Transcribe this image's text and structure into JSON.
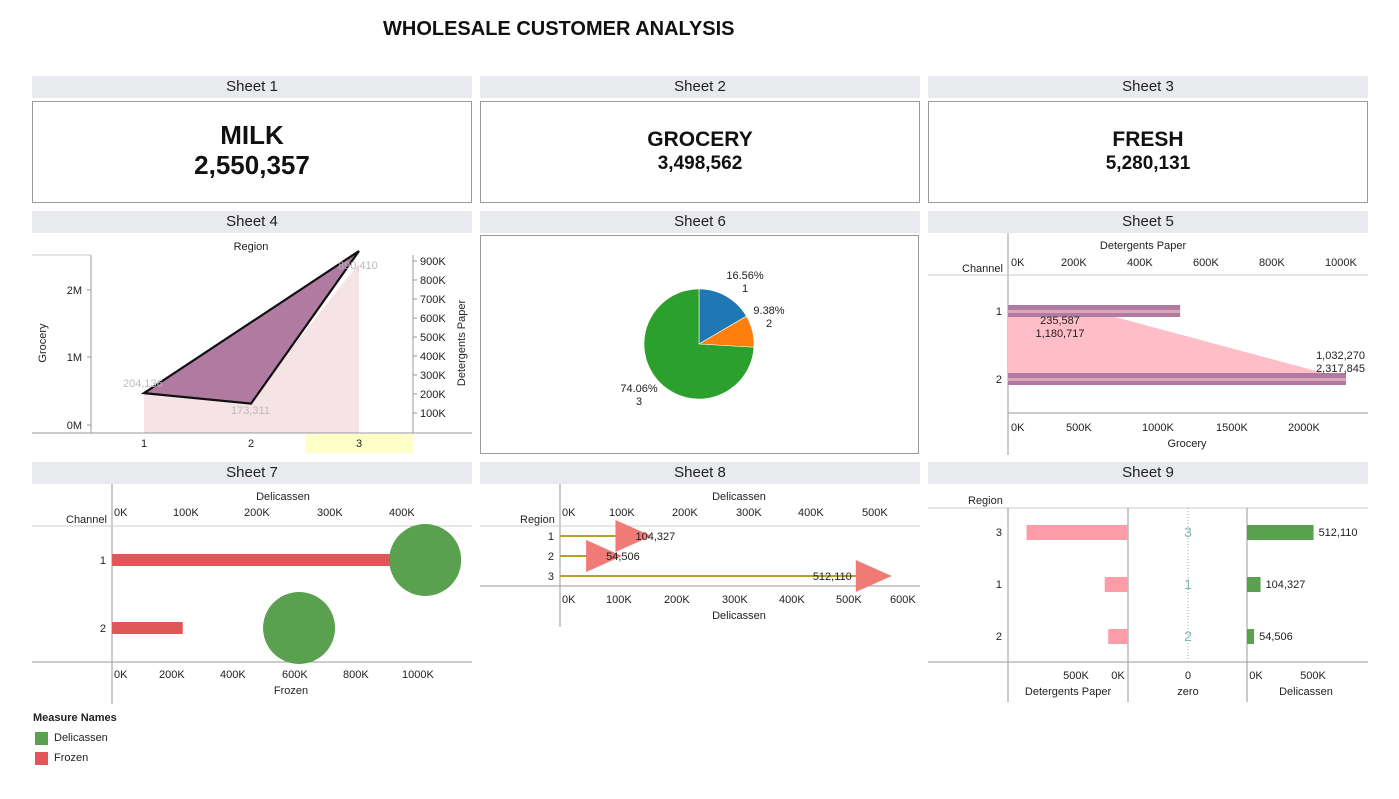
{
  "title": "WHOLESALE CUSTOMER ANALYSIS",
  "sheets": {
    "s1": "Sheet 1",
    "s2": "Sheet 2",
    "s3": "Sheet 3",
    "s4": "Sheet 4",
    "s6": "Sheet 6",
    "s5": "Sheet 5",
    "s7": "Sheet 7",
    "s8": "Sheet 8",
    "s9": "Sheet 9"
  },
  "kpis": {
    "milk": {
      "name": "MILK",
      "value": "2,550,357"
    },
    "grocery": {
      "name": "GROCERY",
      "value": "3,498,562"
    },
    "fresh": {
      "name": "FRESH",
      "value": "5,280,131"
    }
  },
  "colors": {
    "purple": "#b07aa1",
    "pink": "#ffbec7",
    "red": "#e15759",
    "green": "#59a14f",
    "olive": "#b5a12a",
    "blue": "#1f77b4",
    "orange": "#ff7f0e",
    "piegreen": "#2ca02c",
    "lightpink": "#fc9ca8",
    "highlight": "#ffffc8"
  },
  "chart_data": [
    {
      "id": "sheet4",
      "type": "area",
      "title": "Region",
      "categories": [
        "1",
        "2",
        "3"
      ],
      "ylabel": "Grocery",
      "ylabel2": "Detergents Paper",
      "ylim": [
        0,
        2600000
      ],
      "ylim2": [
        0,
        900000
      ],
      "yticks": [
        "0M",
        "1M",
        "2M"
      ],
      "yticks2": [
        "100K",
        "200K",
        "300K",
        "400K",
        "500K",
        "600K",
        "700K",
        "800K",
        "900K"
      ],
      "series": [
        {
          "name": "Grocery",
          "values": [
            570000,
            420000,
            2600000
          ]
        },
        {
          "name": "Detergents Paper",
          "values": [
            204136,
            173311,
            890410
          ]
        }
      ],
      "labels": [
        "204,136",
        "173,311",
        "890,410"
      ],
      "highlight_category": "3"
    },
    {
      "id": "sheet6",
      "type": "pie",
      "slices": [
        {
          "label": "1",
          "percent": 16.56,
          "text": "16.56%"
        },
        {
          "label": "2",
          "percent": 9.38,
          "text": "9.38%"
        },
        {
          "label": "3",
          "percent": 74.06,
          "text": "74.06%"
        }
      ]
    },
    {
      "id": "sheet5",
      "type": "bar",
      "categories": [
        "1",
        "2"
      ],
      "ylabel": "Channel",
      "xlabel_top": "Detergents Paper",
      "xlabel_bottom": "Grocery",
      "xticks_top": [
        "0K",
        "200K",
        "400K",
        "600K",
        "800K",
        "1000K"
      ],
      "xticks_bottom": [
        "0K",
        "500K",
        "1000K",
        "1500K",
        "2000K"
      ],
      "xlim_top": [
        0,
        1080000
      ],
      "xlim_bottom": [
        0,
        2400000
      ],
      "series": [
        {
          "name": "Grocery",
          "values": [
            1180717,
            2317845
          ]
        },
        {
          "name": "Detergents Paper",
          "values": [
            235587,
            1032270
          ]
        }
      ],
      "labels": [
        [
          "235,587",
          "1,180,717"
        ],
        [
          "1,032,270",
          "2,317,845"
        ]
      ]
    },
    {
      "id": "sheet7",
      "type": "bar",
      "categories": [
        "1",
        "2"
      ],
      "ylabel": "Channel",
      "xlabel_top": "Delicassen",
      "xlabel_bottom": "Frozen",
      "xticks_top": [
        "0K",
        "100K",
        "200K",
        "300K",
        "400K"
      ],
      "xticks_bottom": [
        "0K",
        "200K",
        "400K",
        "600K",
        "800K",
        "1000K"
      ],
      "xlim_top": [
        0,
        485000
      ],
      "xlim_bottom": [
        0,
        1170000
      ],
      "series": [
        {
          "name": "Frozen",
          "values": [
            930000,
            230000
          ]
        },
        {
          "name": "Delicassen",
          "values": [
            421955,
            251999
          ]
        }
      ]
    },
    {
      "id": "sheet8",
      "type": "bar",
      "categories": [
        "1",
        "2",
        "3"
      ],
      "ylabel": "Region",
      "xlabel_top": "Delicassen",
      "xlabel_bottom": "Delicassen",
      "xticks_top": [
        "0K",
        "100K",
        "200K",
        "300K",
        "400K",
        "500K"
      ],
      "xticks_bottom": [
        "0K",
        "100K",
        "200K",
        "300K",
        "400K",
        "500K",
        "600K"
      ],
      "xlim_top": [
        0,
        560000
      ],
      "xlim_bottom": [
        0,
        620000
      ],
      "series": [
        {
          "name": "Delicassen",
          "values": [
            104327,
            54506,
            512110
          ]
        }
      ],
      "labels": [
        "104,327",
        "54,506",
        "512,110"
      ]
    },
    {
      "id": "sheet9",
      "type": "bar",
      "categories": [
        "3",
        "1",
        "2"
      ],
      "ylabel": "Region",
      "xlabels": [
        "Detergents Paper",
        "zero",
        "Delicassen"
      ],
      "xticks_left": [
        "500K",
        "0K"
      ],
      "xticks_mid": [
        "0"
      ],
      "xticks_right": [
        "0K",
        "500K"
      ],
      "series": [
        {
          "name": "Detergents Paper",
          "values": [
            890410,
            204136,
            173311
          ]
        },
        {
          "name": "Delicassen",
          "values": [
            512110,
            104327,
            54506
          ]
        }
      ],
      "labels": [
        "512,110",
        "104,327",
        "54,506"
      ]
    }
  ],
  "legend": {
    "title": "Measure Names",
    "items": [
      {
        "label": "Delicassen",
        "color": "#59a14f"
      },
      {
        "label": "Frozen",
        "color": "#e15759"
      }
    ]
  }
}
